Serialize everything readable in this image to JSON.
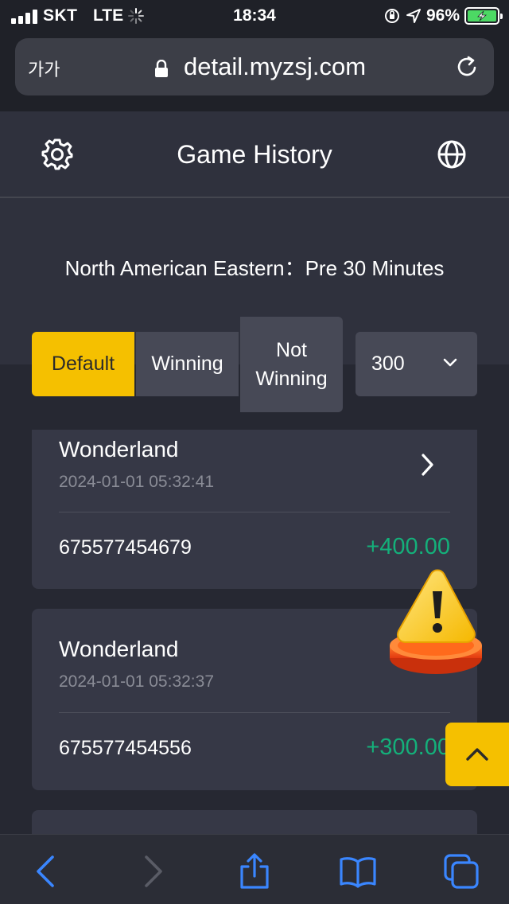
{
  "status_bar": {
    "carrier": "SKT",
    "network": "LTE",
    "time": "18:34",
    "battery_percent": "96%"
  },
  "browser": {
    "text_size_label": "가가",
    "url": "detail.myzsj.com"
  },
  "header": {
    "title": "Game History",
    "icons": [
      "gear-icon",
      "globe-icon"
    ]
  },
  "timezone_text": "North American Eastern：Pre 30 Minutes",
  "filter": {
    "tabs": [
      {
        "label": "Default",
        "active": true
      },
      {
        "label": "Winning",
        "active": false
      },
      {
        "label": "Not Winning",
        "active": false
      }
    ],
    "count_value": "300"
  },
  "records": [
    {
      "game": "Wonderland",
      "time": "2024-01-01 05:32:41",
      "id": "675577454679",
      "amount": "+400.00"
    },
    {
      "game": "Wonderland",
      "time": "2024-01-01 05:32:37",
      "id": "675577454556",
      "amount": "+300.00"
    }
  ],
  "colors": {
    "accent": "#f5c000",
    "win_green": "#14b07a",
    "background": "#262832",
    "header_bg": "#2f313d",
    "card_bg": "#363846",
    "ios_blue": "#3a86ff"
  },
  "toolbar": {
    "icons": [
      "back-icon",
      "forward-icon",
      "share-icon",
      "bookmarks-icon",
      "tabs-icon"
    ]
  }
}
